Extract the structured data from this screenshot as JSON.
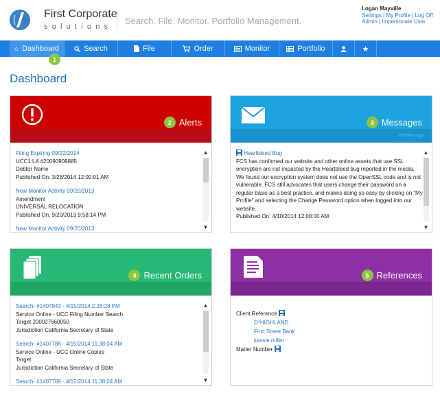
{
  "header": {
    "brand_name": "First Corporate",
    "brand_sub": "solutions",
    "tagline": "Search. File. Monitor. Portfolio Management.",
    "user": "Logan Mayville",
    "links_line1": [
      "Settings",
      "My Profile",
      "Log Off"
    ],
    "links_line2": [
      "Admin",
      "Impersonate User"
    ],
    "separator": "|"
  },
  "nav": {
    "items": [
      {
        "label": "Dashboard",
        "icon": "home-icon"
      },
      {
        "label": "Search",
        "icon": "search-icon"
      },
      {
        "label": "File",
        "icon": "file-icon"
      },
      {
        "label": "Order",
        "icon": "cart-icon"
      },
      {
        "label": "Monitor",
        "icon": "monitor-icon"
      },
      {
        "label": "Portfolio",
        "icon": "portfolio-icon"
      },
      {
        "label": "",
        "icon": "user-icon"
      },
      {
        "label": "",
        "icon": "star-icon"
      }
    ],
    "active_badge": "1"
  },
  "page_title": "Dashboard",
  "alerts": {
    "badge": "2",
    "title": "Alerts",
    "color": "#cc0000",
    "band_color": "#b80d17",
    "items": [
      {
        "link": "Filing Expiring 09/22/2014",
        "lines": [
          "UCC1 LA #20090909885",
          "Debtor Name",
          "Published On: 3/26/2014 12:00:01 AM"
        ]
      },
      {
        "link": "New Monitor Activity 09/20/2013",
        "lines": [
          "Amendment",
          "UNIVERSAL RELOCATION",
          "Published On: 9/20/2013 9:58:14 PM"
        ]
      },
      {
        "link": "New Monitor Activity 09/20/2013",
        "lines": []
      }
    ]
  },
  "messages": {
    "badge": "3",
    "title": "Messages",
    "color": "#1fa3e0",
    "band_color": "#1891cc",
    "add_label": "Add Message",
    "item": {
      "link": "Heartbleed Bug",
      "body": "FCS has confirmed our website and other online assets that use SSL encryption are not impacted by the Heartbleed bug reported in the media. We found our encryption system does not use the OpenSSL code and is not vulnerable. FCS still advocates that users change their password on a regular basis as a best practice, and makes doing so easy by clicking on “My Profile” and selecting the Change Password option when logged into our website.",
      "published": "Published On: 4/10/2014 12:00:00 AM"
    }
  },
  "orders": {
    "badge": "4",
    "title": "Recent Orders",
    "color": "#27b875",
    "band_color": "#1fa664",
    "items": [
      {
        "link": "Search- #1407943 - 4/15/2014 2:26:28 PM",
        "lines": [
          "Service Online - UCC Filing Number Search",
          "Target 200027660050",
          "Jurisdiction California Secretary of State"
        ]
      },
      {
        "link": "Search- #1407788 - 4/15/2014 11:38:04 AM",
        "lines": [
          "Service Online - UCC Online Copies",
          "Target",
          "Jurisdiction California Secretary of State"
        ]
      },
      {
        "link": "Search- #1407788 - 4/15/2014 11:38:04 AM",
        "lines": []
      }
    ]
  },
  "references": {
    "badge": "5",
    "title": "References",
    "color": "#8e2fa6",
    "band_color": "#7b2591",
    "client_label": "Client Reference",
    "client_values": [
      "D*HIGHLAND",
      "First Street Bank",
      "kassie miller"
    ],
    "matter_label": "Matter Number"
  }
}
